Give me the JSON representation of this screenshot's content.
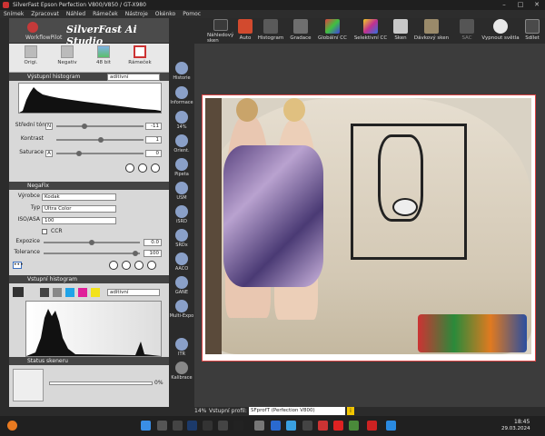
{
  "window": {
    "title": "SilverFast  Epson Perfection V800/V850 / GT-X980"
  },
  "menu": [
    "Snímek",
    "Zpracovat",
    "Náhled",
    "Rámeček",
    "Nástroje",
    "Okénko",
    "Pomoc"
  ],
  "toolbar": {
    "brand": "SilverFast Ai Studio",
    "workflow": "WorkflowPilot",
    "items": [
      {
        "label": "Náhledový sken",
        "color": "#3a3a3a"
      },
      {
        "label": "Auto",
        "color": "#d24a2e"
      },
      {
        "label": "Histogram",
        "color": "#5a5a5a"
      },
      {
        "label": "Gradace",
        "color": "#6f6f6f"
      },
      {
        "label": "Globální CC",
        "color": "#e0a030"
      },
      {
        "label": "Selektivní CC",
        "color": "#8a3fc2"
      },
      {
        "label": "Sken",
        "color": "#c8c8c8"
      },
      {
        "label": "Dávkový sken",
        "color": "#9a8a6a"
      },
      {
        "label": "SAC",
        "color": "#555555"
      },
      {
        "label": "Vypnout světla",
        "color": "#e8e8e8"
      },
      {
        "label": "Sdílet",
        "color": "#4a4a4a"
      }
    ]
  },
  "modes": [
    {
      "label": "Origi."
    },
    {
      "label": "Negativ"
    },
    {
      "label": "48 bit"
    },
    {
      "label": "Rámeček"
    }
  ],
  "output_hist": {
    "title": "Výstupní histogram",
    "mode": "aditivní"
  },
  "adjust": {
    "midtone_label": "Střední tón",
    "midtone_key": "N",
    "midtone_value": "-11",
    "contrast_label": "Kontrast",
    "contrast_value": "1",
    "saturation_label": "Saturace",
    "saturation_key": "A",
    "saturation_value": "0"
  },
  "negafix": {
    "title": "NegaFix",
    "maker_label": "Výrobce",
    "maker": "Kodak",
    "type_label": "Typ",
    "type": "Ultra Color",
    "iso_label": "ISO/ASA",
    "iso": "100",
    "ccr": "CCR",
    "exposure_label": "Expozice",
    "exposure_value": "0.0",
    "tolerance_label": "Tolerance",
    "tolerance_value": "100"
  },
  "input_hist": {
    "title": "Vstupní histogram",
    "mode": "aditivní"
  },
  "scanner_status": {
    "title": "Status skeneru",
    "percent": "0%"
  },
  "vtools": [
    {
      "label": "Historie"
    },
    {
      "label": "Informace"
    },
    {
      "label": "14%"
    },
    {
      "label": "Orient."
    },
    {
      "label": "Pipeta"
    },
    {
      "label": "USM"
    },
    {
      "label": "iSRD"
    },
    {
      "label": "SRDx"
    },
    {
      "label": "AACO"
    },
    {
      "label": "GANE"
    },
    {
      "label": "Multi-Expo"
    },
    {
      "label": "ITR"
    },
    {
      "label": "Kalibrace"
    }
  ],
  "status": {
    "zoom": "14%",
    "profile_label": "Vstupní profil:",
    "profile_value": "SFprofT (Perfection V800)"
  },
  "taskbar": {
    "time": "18:45",
    "date": "29.03.2024"
  }
}
